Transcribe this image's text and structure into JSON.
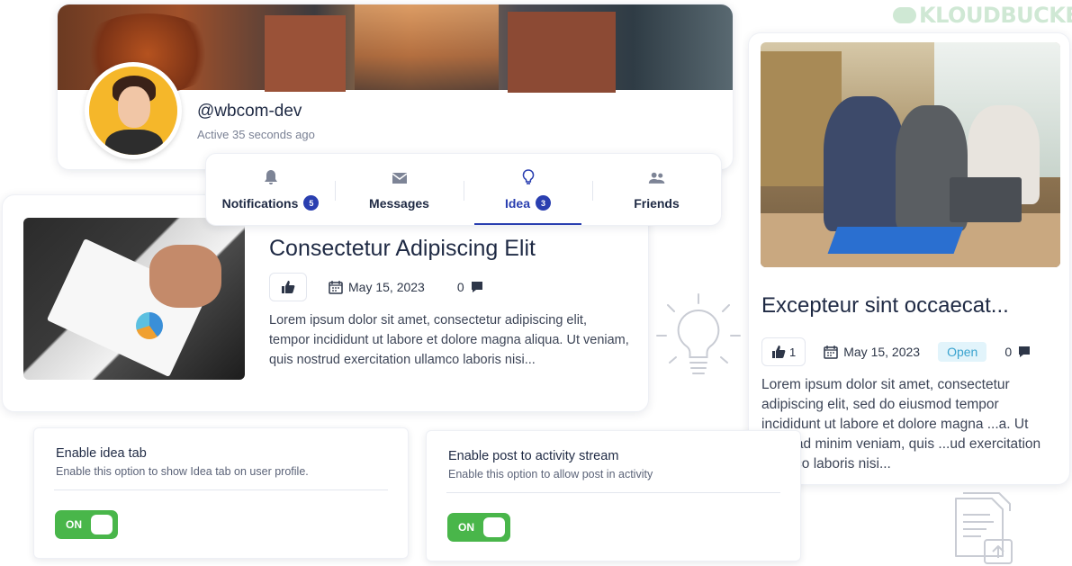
{
  "logo": {
    "text": "KLOUDBUCKET"
  },
  "profile": {
    "handle": "@wbcom-dev",
    "active": "Active 35 seconds ago"
  },
  "tabs": [
    {
      "label": "Notifications",
      "badge": "5",
      "icon": "bell-icon"
    },
    {
      "label": "Messages",
      "badge": "",
      "icon": "envelope-icon"
    },
    {
      "label": "Idea",
      "badge": "3",
      "icon": "lightbulb-icon",
      "active": true
    },
    {
      "label": "Friends",
      "badge": "",
      "icon": "users-icon"
    }
  ],
  "idea_left": {
    "title": "Consectetur Adipiscing Elit",
    "date": "May 15, 2023",
    "comments": "0",
    "desc": "Lorem ipsum dolor sit amet, consectetur adipiscing elit, tempor incididunt ut labore et dolore magna aliqua. Ut veniam, quis nostrud exercitation ullamco laboris nisi..."
  },
  "idea_right": {
    "title": "Excepteur sint occaecat...",
    "likes": "1",
    "date": "May 15, 2023",
    "status": "Open",
    "comments": "0",
    "desc": "Lorem ipsum dolor sit amet, consectetur adipiscing elit, sed do eiusmod tempor incididunt ut labore et dolore magna ...a. Ut enim ad minim veniam, quis ...ud exercitation ullamco laboris nisi..."
  },
  "settings": [
    {
      "title": "Enable idea tab",
      "sub": "Enable this option to show Idea tab on user profile.",
      "toggle": "ON"
    },
    {
      "title": "Enable post to activity stream",
      "sub": "Enable this option to allow post in activity",
      "toggle": "ON"
    }
  ],
  "colors": {
    "accent": "#2a3fb0",
    "toggle_on": "#49b64a",
    "status_open_bg": "#e2f4fb"
  }
}
